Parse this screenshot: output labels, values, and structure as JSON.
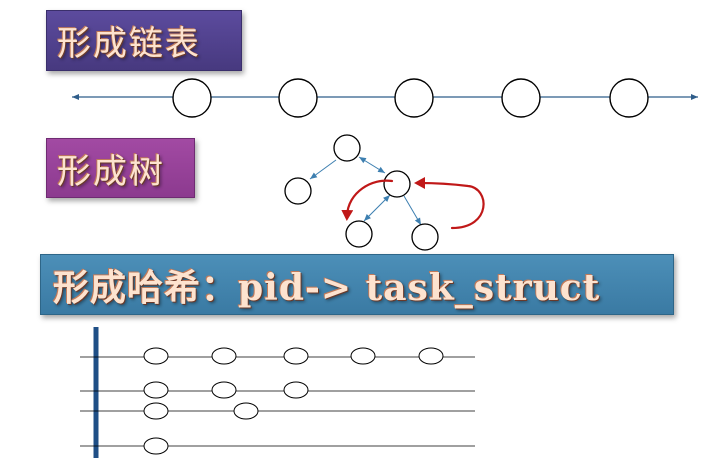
{
  "headings": {
    "list": "形成链表",
    "tree": "形成树",
    "hash": "形成哈希：pid-> task_struct"
  },
  "colors": {
    "list_box": "#4b3d88",
    "tree_box": "#953f98",
    "hash_box": "#4285ad",
    "heading_text": "#fde3cf",
    "list_line": "#2f5d8a",
    "tree_line": "#3d7fb0",
    "red_arrow": "#c01818",
    "node_stroke": "#000000"
  }
}
